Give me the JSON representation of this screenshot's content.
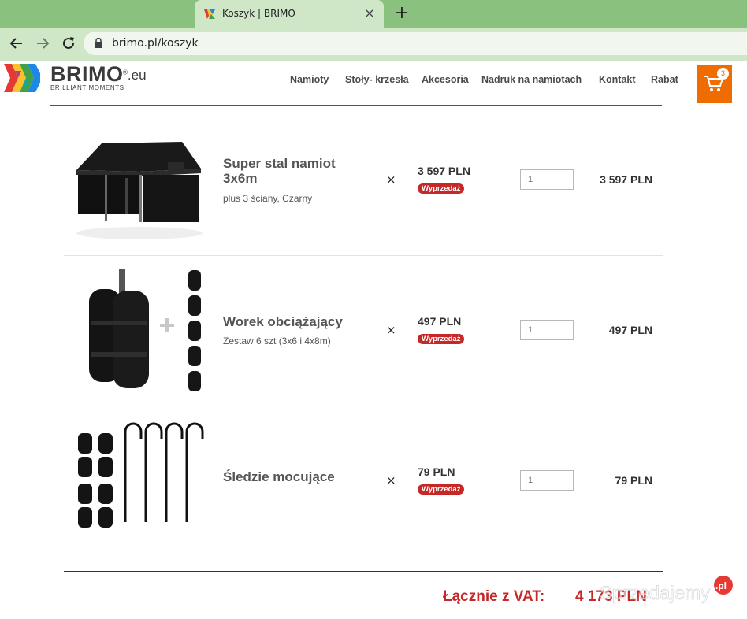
{
  "browser": {
    "tab_title": "Koszyk | BRIMO",
    "tab_close": "×",
    "new_tab": "+",
    "url": "brimo.pl/koszyk",
    "icons": [
      "back-arrow-icon",
      "forward-arrow-icon",
      "reload-icon",
      "lock-icon"
    ]
  },
  "site": {
    "logo_text": "BRIMO",
    "logo_suffix": ".eu",
    "logo_registered": "®",
    "tagline": "BRILLIANT MOMENTS",
    "nav": [
      "Namioty",
      "Stoły- krzesła",
      "Akcesoria",
      "Nadruk na namiotach",
      "Kontakt",
      "Rabat"
    ],
    "cart_count": "3",
    "accent_color": "#ef6c00"
  },
  "cart": {
    "items": [
      {
        "name": "Super stal namiot 3x6m",
        "variant": "plus 3 ściany, Czarny",
        "times": "×",
        "price": "3 597 PLN",
        "badge": "Wyprzedaż",
        "qty": "1",
        "total": "3 597 PLN"
      },
      {
        "name": "Worek obciążający",
        "variant": "Zestaw 6 szt (3x6 i 4x8m)",
        "times": "×",
        "price": "497 PLN",
        "badge": "Wyprzedaż",
        "qty": "1",
        "total": "497 PLN"
      },
      {
        "name": "Śledzie mocujące",
        "variant": "",
        "times": "×",
        "price": "79 PLN",
        "badge": "Wyprzedaż",
        "qty": "1",
        "total": "79 PLN"
      }
    ],
    "total_label": "Łącznie z VAT:",
    "total_value": "4 173 PLN",
    "sale_color": "#c62828"
  },
  "watermark": {
    "text": "Sprzedajemy",
    "suffix": ".pl"
  }
}
